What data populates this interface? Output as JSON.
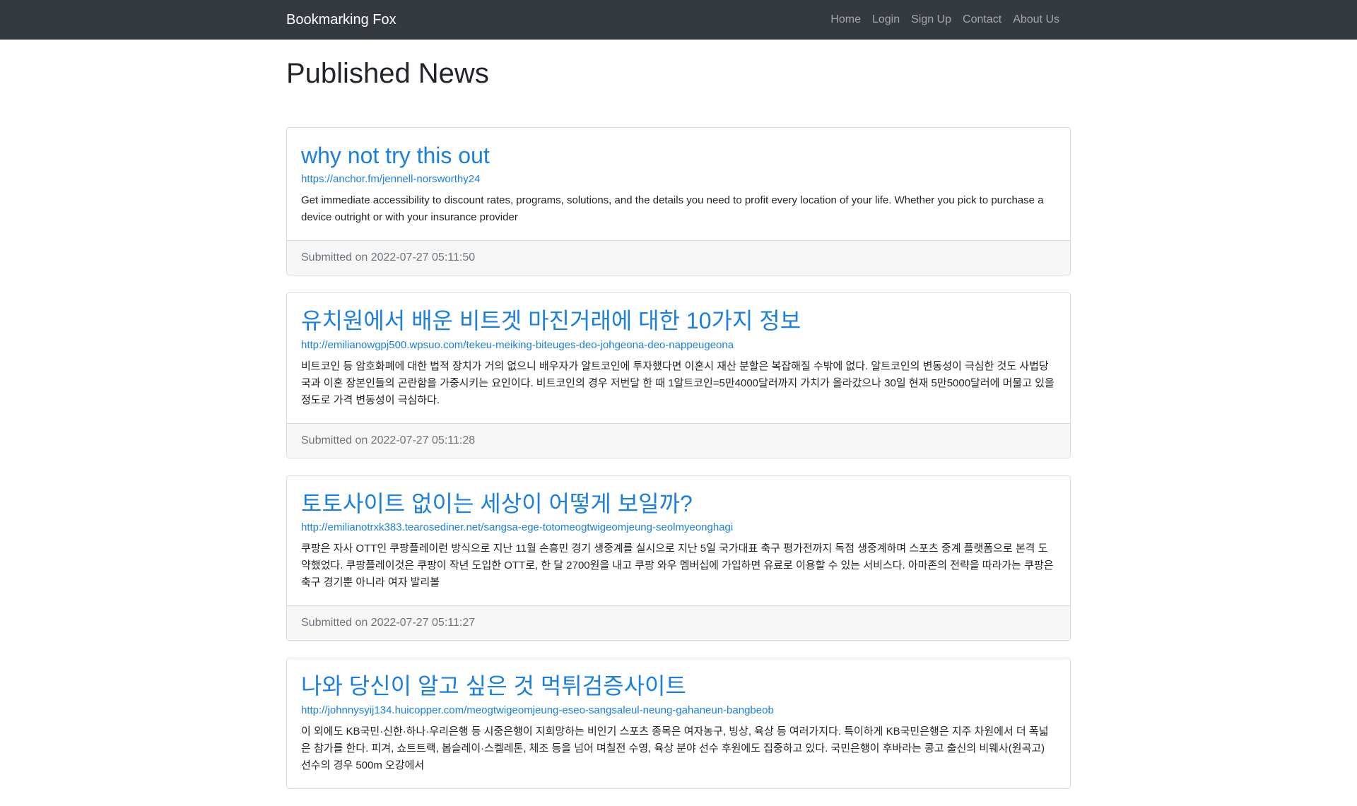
{
  "navbar": {
    "brand": "Bookmarking Fox",
    "links": [
      "Home",
      "Login",
      "Sign Up",
      "Contact",
      "About Us"
    ]
  },
  "page": {
    "title": "Published News"
  },
  "colors": {
    "navbar_bg": "#343a40",
    "link": "#1a7fe0",
    "footer_text": "#6c757d"
  },
  "news": [
    {
      "title": "why not try this out",
      "url": "https://anchor.fm/jennell-norsworthy24",
      "description": "Get immediate accessibility to discount rates, programs, solutions, and the details you need to profit every location of your life. Whether you pick to purchase a device outright or with your insurance provider",
      "submitted": "Submitted on 2022-07-27 05:11:50"
    },
    {
      "title": "유치원에서 배운 비트겟 마진거래에 대한 10가지 정보",
      "url": "http://emilianowgpj500.wpsuo.com/tekeu-meiking-biteuges-deo-johgeona-deo-nappeugeona",
      "description": "비트코인 등 암호화폐에 대한 법적 장치가 거의 없으니 배우자가 알트코인에 투자했다면 이혼시 재산 분할은 복잡해질 수밖에 없다. 알트코인의 변동성이 극심한 것도 사법당국과 이혼 장본인들의 곤란함을 가중시키는 요인이다. 비트코인의 경우 저번달 한 때 1알트코인=5만4000달러까지 가치가 올라갔으나 30일 현재 5만5000달러에 머물고 있을 정도로 가격 변동성이 극심하다.",
      "submitted": "Submitted on 2022-07-27 05:11:28"
    },
    {
      "title": "토토사이트 없이는 세상이 어떻게 보일까?",
      "url": "http://emilianotrxk383.tearosediner.net/sangsa-ege-totomeogtwigeomjeung-seolmyeonghagi",
      "description": "쿠팡은 자사 OTT인 쿠팡플레이런 방식으로 지난 11월 손흥민 경기 생중계를 실시으로 지난 5일 국가대표 축구 평가전까지 독점 생중계하며 스포츠 중계 플랫폼으로 본격 도약했었다. 쿠팡플레이것은 쿠팡이 작년 도입한 OTT로, 한 달 2700원을 내고 쿠팡 와우 멤버십에 가입하면 유료로 이용할 수 있는 서비스다. 아마존의 전략을 따라가는 쿠팡은 축구 경기뿐 아니라 여자 발리볼",
      "submitted": "Submitted on 2022-07-27 05:11:27"
    },
    {
      "title": "나와 당신이 알고 싶은 것 먹튀검증사이트",
      "url": "http://johnnysyij134.huicopper.com/meogtwigeomjeung-eseo-sangsaleul-neung-gahaneun-bangbeob",
      "description": "이 외에도 KB국민·신한·하나·우리은행 등 시중은행이 지희망하는 비인기 스포츠 종목은 여자농구, 빙상, 육상 등 여러가지다. 특이하게 KB국민은행은 지주 차원에서 더 폭넓은 참가를 한다. 피겨, 쇼트트랙, 봅슬레이·스켈레톤, 체조 등을 넘어 며칠전 수영, 육상 분야 선수 후원에도 집중하고 있다. 국민은행이 후바라는 콩고 출신의 비웨사(원곡고) 선수의 경우 500m 오강에서",
      "submitted": ""
    }
  ]
}
